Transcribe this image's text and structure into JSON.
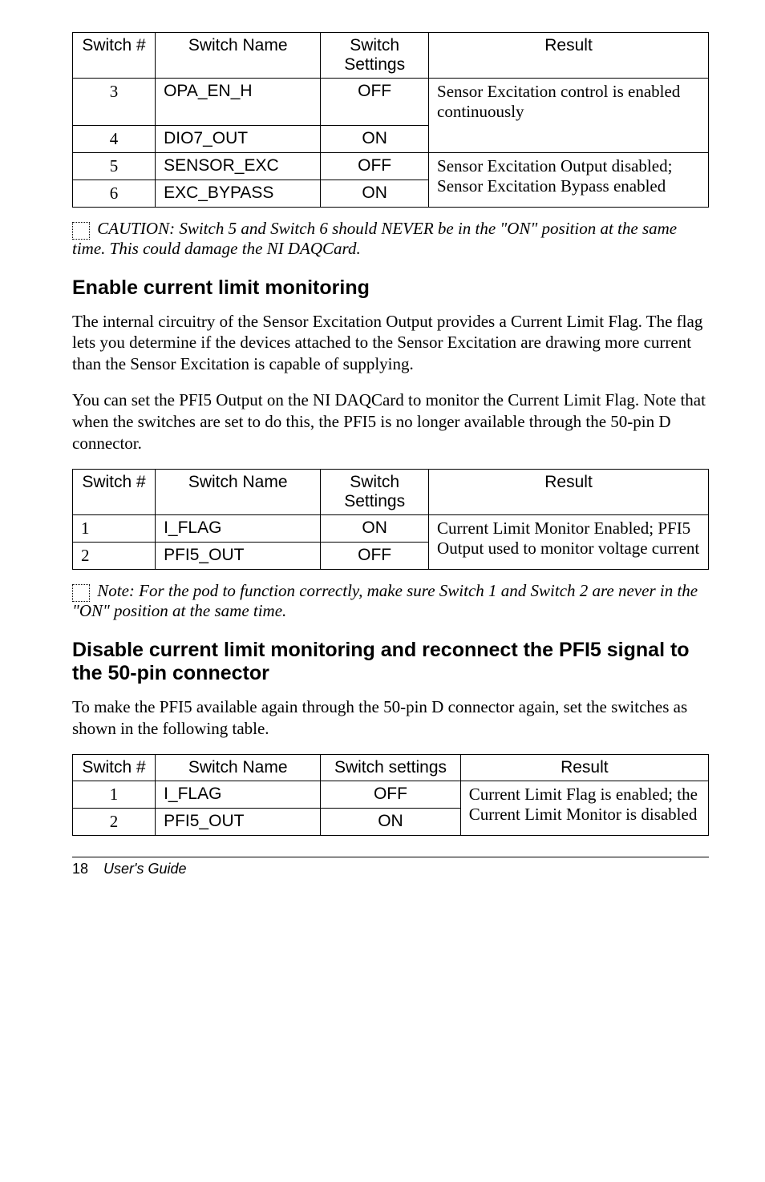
{
  "table1": {
    "headers": [
      "Switch #",
      "Switch Name",
      "Switch Settings",
      "Result"
    ],
    "rows": [
      {
        "num": "3",
        "name": "OPA_EN_H",
        "set": "OFF",
        "res": "Sensor Excitation control is enabled continuously"
      },
      {
        "num": "4",
        "name": "DIO7_OUT",
        "set": "ON",
        "res": ""
      },
      {
        "num": "5",
        "name": "SENSOR_EXC",
        "set": "OFF",
        "res": "Sensor Excitation Output disabled; Sensor Excitation Bypass enabled"
      },
      {
        "num": "6",
        "name": "EXC_BYPASS",
        "set": "ON",
        "res": ""
      }
    ]
  },
  "caution1": " CAUTION: Switch 5 and Switch 6 should NEVER be in the \"ON\" position at the same time. This could damage the NI DAQCard.",
  "head1": "Enable current limit monitoring",
  "para1": "The internal circuitry of the Sensor Excitation Output provides a Current Limit Flag. The flag lets you determine if the devices attached to the Sensor Excitation are drawing more current than the Sensor Excitation is capable of supplying.",
  "para2": "You can set the PFI5 Output on the NI DAQCard to monitor the Current Limit Flag. Note that when the switches are set to do this, the PFI5 is no longer available through the 50-pin D connector.",
  "table2": {
    "headers": [
      "Switch #",
      "Switch Name",
      "Switch Settings",
      "Result"
    ],
    "rows": [
      {
        "num": "1",
        "name": "I_FLAG",
        "set": "ON",
        "res": "Current Limit Monitor Enabled; PFI5 Output used to monitor voltage current"
      },
      {
        "num": "2",
        "name": "PFI5_OUT",
        "set": "OFF",
        "res": ""
      }
    ]
  },
  "caution2": "  Note: For the pod to function correctly, make sure Switch 1 and Switch 2 are never in the \"ON\" position at the same time.",
  "head2": "Disable current limit monitoring and reconnect the PFI5 signal to the 50-pin connector",
  "para3": "To make the PFI5 available again through the 50-pin D connector again, set the switches as shown in the following table.",
  "table3": {
    "headers": [
      "Switch #",
      "Switch Name",
      "Switch settings",
      "Result"
    ],
    "rows": [
      {
        "num": "1",
        "name": "I_FLAG",
        "set": "OFF",
        "res": "Current Limit Flag is enabled; the Current Limit Monitor is disabled"
      },
      {
        "num": "2",
        "name": "PFI5_OUT",
        "set": "ON",
        "res": ""
      }
    ]
  },
  "footer": {
    "page": "18",
    "title": "User's Guide"
  }
}
